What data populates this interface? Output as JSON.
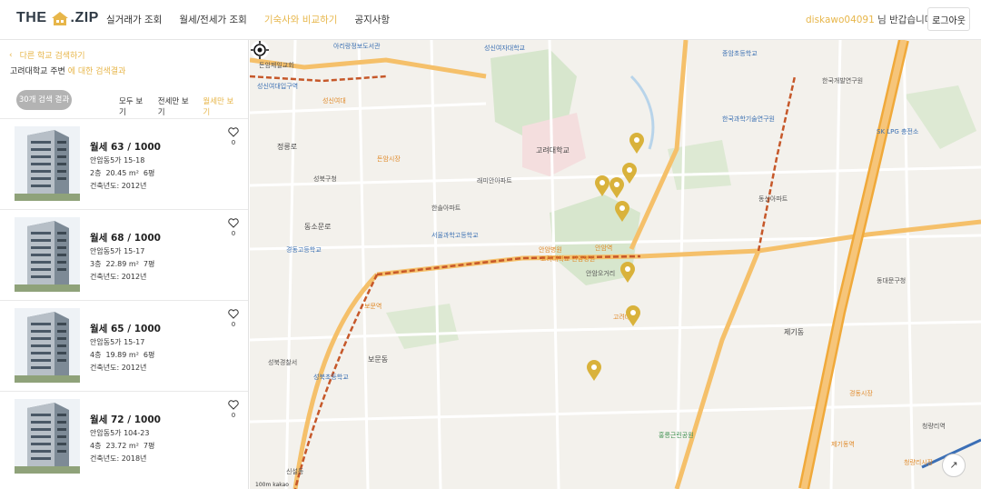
{
  "header": {
    "logo_left": "THE",
    "logo_right": ".ZIP",
    "nav": [
      "실거래가 조회",
      "월세/전세가 조회",
      "기숙사와 비교하기",
      "공지사항"
    ],
    "active_nav": 2,
    "username": "diskawo04091",
    "greeting": " 님 반갑습니다",
    "logout": "로그아웃"
  },
  "sidebar": {
    "back_label": "다른 학교 검색하기",
    "school": "고려대학교 주변",
    "search_suffix": " 에 대한 검색결과",
    "result_count": "30개 검색 결과",
    "filters": [
      "모두 보기",
      "전세만 보기",
      "월세만 보기"
    ],
    "active_filter": 2,
    "built_label": "건축년도: ",
    "listings": [
      {
        "price": "월세 63 / 1000",
        "address": "안암동5가 15-18",
        "floor": "2층",
        "area": "20.45 m²",
        "rooms": "6평",
        "year": "2012년",
        "likes": "0"
      },
      {
        "price": "월세 68 / 1000",
        "address": "안암동5가 15-17",
        "floor": "3층",
        "area": "22.89 m²",
        "rooms": "7평",
        "year": "2012년",
        "likes": "0"
      },
      {
        "price": "월세 65 / 1000",
        "address": "안암동5가 15-17",
        "floor": "4층",
        "area": "19.89 m²",
        "rooms": "6평",
        "year": "2012년",
        "likes": "0"
      },
      {
        "price": "월세 72 / 1000",
        "address": "안암동5가 104-23",
        "floor": "4층",
        "area": "23.72 m²",
        "rooms": "7평",
        "year": "2018년",
        "likes": "0"
      }
    ]
  },
  "map": {
    "scale": "100m",
    "provider": "kakao",
    "labels": [
      "아리랑정보도서관",
      "돈암제일교회",
      "성신여대입구역",
      "성신여대",
      "돈암시장",
      "성신여자대학교",
      "동소문로",
      "성북구청",
      "정릉로",
      "고려대학교",
      "안암병원",
      "제기동",
      "경동시장",
      "청량리시장",
      "한국과학기술연구원",
      "보문역",
      "신설동",
      "안암역",
      "고려대역",
      "홍릉근린공원",
      "한국개발연구원",
      "동대문구청",
      "종암초등학교",
      "성북경찰서",
      "고려대학교 안암병원",
      "안암오거리",
      "보문동",
      "청량리역",
      "제기동역",
      "한솔아파트",
      "서울과학고등학교",
      "경동고등학교",
      "성북초등학교",
      "동신아파트",
      "래미안아파트",
      "SK LPG 충전소"
    ],
    "pin_color": "#d9b23b",
    "road_color": "#f2b44a",
    "subway_color": "#c6582a"
  },
  "colors": {
    "accent": "#e7b64a"
  }
}
